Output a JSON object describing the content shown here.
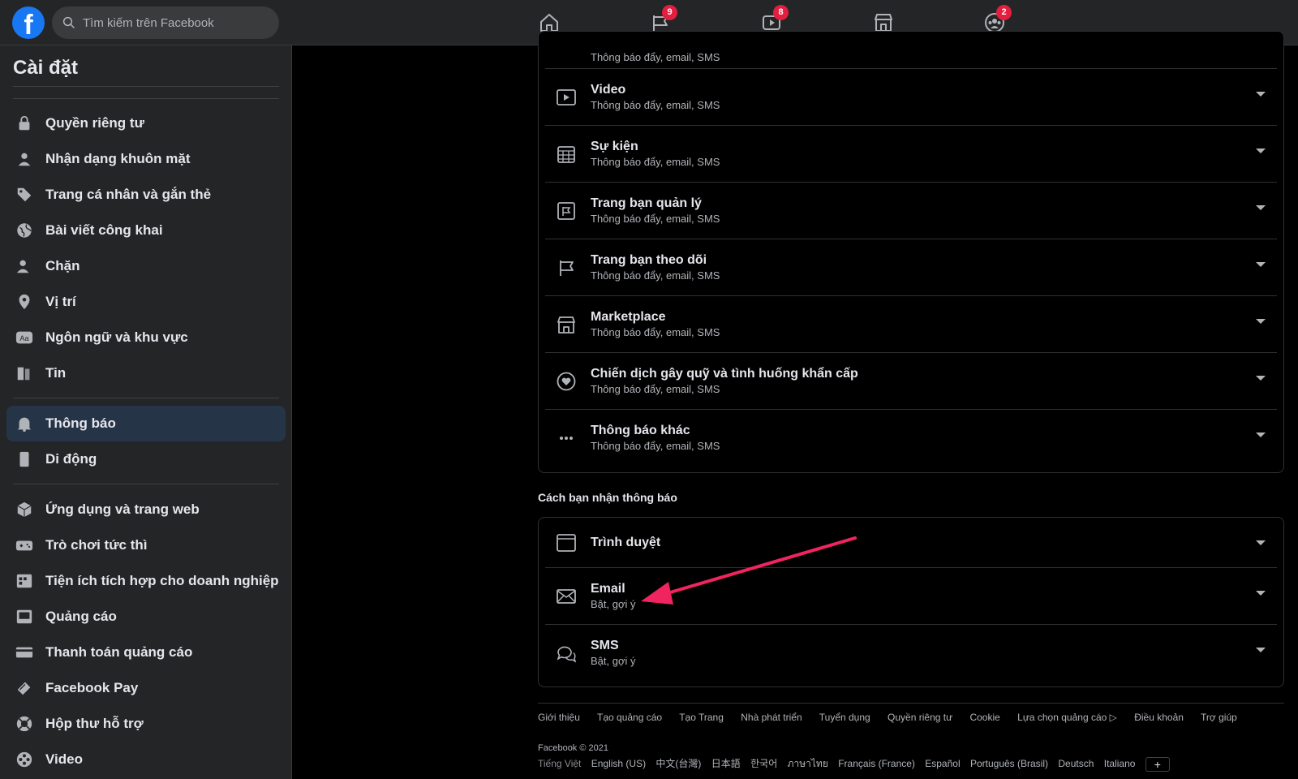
{
  "header": {
    "logo": "f",
    "search_placeholder": "Tìm kiếm trên Facebook",
    "nav": [
      {
        "name": "home-icon",
        "badge": ""
      },
      {
        "name": "pages-flag-icon",
        "badge": "9"
      },
      {
        "name": "watch-video-icon",
        "badge": "8"
      },
      {
        "name": "marketplace-icon",
        "badge": ""
      },
      {
        "name": "groups-icon",
        "badge": "2"
      }
    ]
  },
  "sidebar": {
    "title": "Cài đặt",
    "items": [
      {
        "label": "Quyền riêng tư",
        "icon": "lock-icon"
      },
      {
        "label": "Nhận dạng khuôn mặt",
        "icon": "face-person-icon"
      },
      {
        "label": "Trang cá nhân và gắn thẻ",
        "icon": "tag-icon"
      },
      {
        "label": "Bài viết công khai",
        "icon": "globe-icon"
      },
      {
        "label": "Chặn",
        "icon": "block-person-icon"
      },
      {
        "label": "Vị trí",
        "icon": "location-pin-icon"
      },
      {
        "label": "Ngôn ngữ và khu vực",
        "icon": "language-aa-icon"
      },
      {
        "label": "Tin",
        "icon": "book-icon"
      },
      {
        "label": "Thông báo",
        "icon": "bell-icon",
        "active": true
      },
      {
        "label": "Di động",
        "icon": "mobile-icon"
      },
      {
        "label": "Ứng dụng và trang web",
        "icon": "cube-icon"
      },
      {
        "label": "Trò chơi tức thì",
        "icon": "gamepad-icon"
      },
      {
        "label": "Tiện ích tích hợp cho doanh nghiệp",
        "icon": "business-integration-icon"
      },
      {
        "label": "Quảng cáo",
        "icon": "ad-icon"
      },
      {
        "label": "Thanh toán quảng cáo",
        "icon": "credit-card-icon"
      },
      {
        "label": "Facebook Pay",
        "icon": "pay-icon"
      },
      {
        "label": "Hộp thư hỗ trợ",
        "icon": "lifebuoy-icon"
      },
      {
        "label": "Video",
        "icon": "film-reel-icon"
      }
    ]
  },
  "notification_types": [
    {
      "title": "",
      "sub": "Thông báo đẩy, email, SMS",
      "icon": "partial-icon"
    },
    {
      "title": "Video",
      "sub": "Thông báo đẩy, email, SMS",
      "icon": "video-icon"
    },
    {
      "title": "Sự kiện",
      "sub": "Thông báo đẩy, email, SMS",
      "icon": "calendar-icon"
    },
    {
      "title": "Trang bạn quản lý",
      "sub": "Thông báo đẩy, email, SMS",
      "icon": "page-manage-icon"
    },
    {
      "title": "Trang bạn theo dõi",
      "sub": "Thông báo đẩy, email, SMS",
      "icon": "flag-icon"
    },
    {
      "title": "Marketplace",
      "sub": "Thông báo đẩy, email, SMS",
      "icon": "shop-icon"
    },
    {
      "title": "Chiến dịch gây quỹ và tình huống khẩn cấp",
      "sub": "Thông báo đẩy, email, SMS",
      "icon": "heart-donation-icon"
    },
    {
      "title": "Thông báo khác",
      "sub": "Thông báo đẩy, email, SMS",
      "icon": "more-dots-icon"
    }
  ],
  "delivery": {
    "section_title": "Cách bạn nhận thông báo",
    "rows": [
      {
        "title": "Trình duyệt",
        "sub": "",
        "icon": "browser-icon"
      },
      {
        "title": "Email",
        "sub": "Bật, gợi ý",
        "icon": "envelope-icon"
      },
      {
        "title": "SMS",
        "sub": "Bật, gợi ý",
        "icon": "chat-bubble-icon"
      }
    ]
  },
  "footer": {
    "links": [
      "Giới thiệu",
      "Tạo quảng cáo",
      "Tạo Trang",
      "Nhà phát triển",
      "Tuyển dụng",
      "Quyền riêng tư",
      "Cookie",
      "Lựa chọn quảng cáo ▷",
      "Điều khoản",
      "Trợ giúp"
    ],
    "copyright": "Facebook © 2021",
    "languages": [
      "Tiếng Việt",
      "English (US)",
      "中文(台灣)",
      "日本語",
      "한국어",
      "ภาษาไทย",
      "Français (France)",
      "Español",
      "Português (Brasil)",
      "Deutsch",
      "Italiano"
    ],
    "more_languages": "+"
  },
  "colors": {
    "accent": "#1877f2",
    "badge": "#e41e3f",
    "annotation_arrow": "#f0245f"
  }
}
